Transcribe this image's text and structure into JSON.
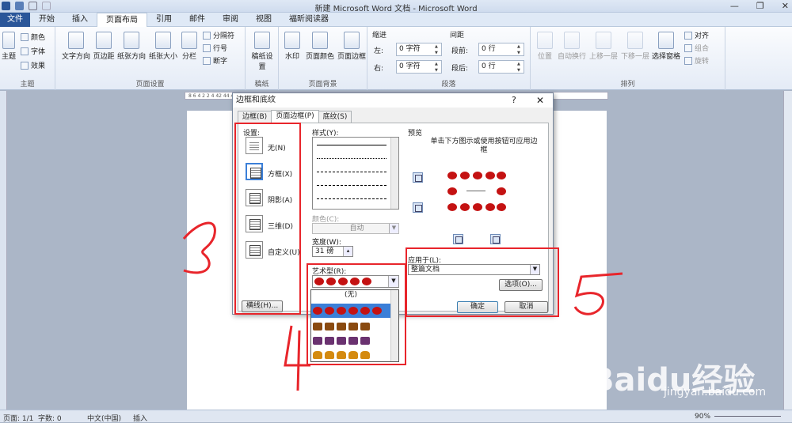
{
  "app": {
    "title": "新建 Microsoft Word 文档 - Microsoft Word",
    "window_controls": [
      "—",
      "❐",
      "✕"
    ]
  },
  "tabs": [
    "文件",
    "开始",
    "插入",
    "页面布局",
    "引用",
    "邮件",
    "审阅",
    "视图",
    "福昕阅读器"
  ],
  "ribbon": {
    "theme_group": {
      "label": "主题",
      "button": "主题",
      "colors": "颜色",
      "fonts": "字体",
      "effects": "效果"
    },
    "page_setup": {
      "label": "页面设置",
      "text_direction": "文字方向",
      "margins": "页边距",
      "orientation": "纸张方向",
      "size": "纸张大小",
      "columns": "分栏",
      "breaks": "分隔符",
      "line_numbers": "行号",
      "hyphenation": "断字"
    },
    "draft": {
      "label": "稿纸",
      "button": "稿纸设置"
    },
    "page_bg": {
      "label": "页面背景",
      "watermark": "水印",
      "page_color": "页面颜色",
      "page_borders": "页面边框"
    },
    "paragraph": {
      "label": "段落",
      "indent": "缩进",
      "spacing": "间距",
      "left_label": "左:",
      "right_label": "右:",
      "before_label": "段前:",
      "after_label": "段后:",
      "left": "0 字符",
      "right": "0 字符",
      "before": "0 行",
      "after": "0 行"
    },
    "arrange": {
      "label": "排列",
      "position": "位置",
      "wrap": "自动换行",
      "forward": "上移一层",
      "backward": "下移一层",
      "selection": "选择窗格",
      "align": "对齐",
      "group": "组合",
      "rotate": "旋转"
    }
  },
  "ruler_text": "8   6   4   2       2   4       42  44  46  48",
  "dialog": {
    "title": "边框和底纹",
    "help": "?",
    "close": "✕",
    "tabs": [
      "边框(B)",
      "页面边框(P)",
      "底纹(S)"
    ],
    "settings_label": "设置:",
    "settings": [
      "无(N)",
      "方框(X)",
      "阴影(A)",
      "三维(D)",
      "自定义(U)"
    ],
    "style_label": "样式(Y):",
    "color_label": "颜色(C):",
    "color_value": "自动",
    "width_label": "宽度(W):",
    "width_value": "31 磅",
    "art_label": "艺术型(R):",
    "art_none": "(无)",
    "preview_label": "预览",
    "preview_hint": "单击下方图示或使用按钮可应用边框",
    "apply_label": "应用于(L):",
    "apply_value": "整篇文档",
    "options_button": "选项(O)...",
    "ok_button": "确定",
    "cancel_button": "取消",
    "hline_button": "横线(H)..."
  },
  "status": {
    "page": "页面: 1/1",
    "words": "字数: 0",
    "language": "中文(中国)",
    "insert": "插入",
    "zoom": "90%"
  },
  "annotations": [
    "3",
    "4",
    "5"
  ],
  "watermark": {
    "brand": "Baidu经验",
    "url": "jingyan.baidu.com"
  },
  "colors": {
    "accent": "#2a5699",
    "highlight": "#e8252b",
    "art_red": "#c41212",
    "selection": "#3b7fd8"
  }
}
